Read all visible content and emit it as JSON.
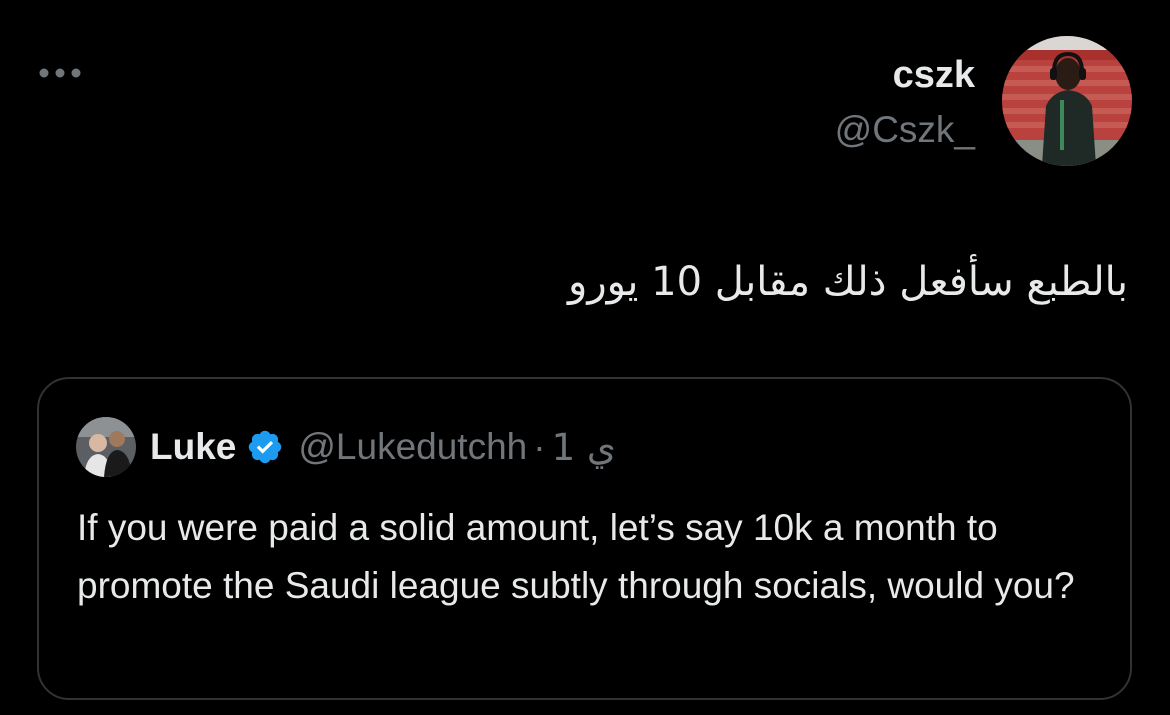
{
  "tweet": {
    "author": {
      "display_name": "cszk",
      "handle": "@Cszk_",
      "avatar_icon": "profile-photo-footballer"
    },
    "more_icon": "more-horizontal-icon",
    "text": "بالطبع سأفعل ذلك مقابل 10 يورو"
  },
  "quoted_tweet": {
    "author": {
      "display_name": "Luke",
      "handle": "@Lukedutchh",
      "verified": true,
      "verified_color": "#1d9bf0",
      "avatar_icon": "profile-photo-two-people"
    },
    "separator": "·",
    "time": "1 ي",
    "text": "If you were paid a solid amount, let’s say 10k a month to promote the Saudi league subtly through socials, would you?"
  },
  "colors": {
    "background": "#000000",
    "primary_text": "#e7e9ea",
    "secondary_text": "#71767b",
    "border": "#2f3336"
  }
}
